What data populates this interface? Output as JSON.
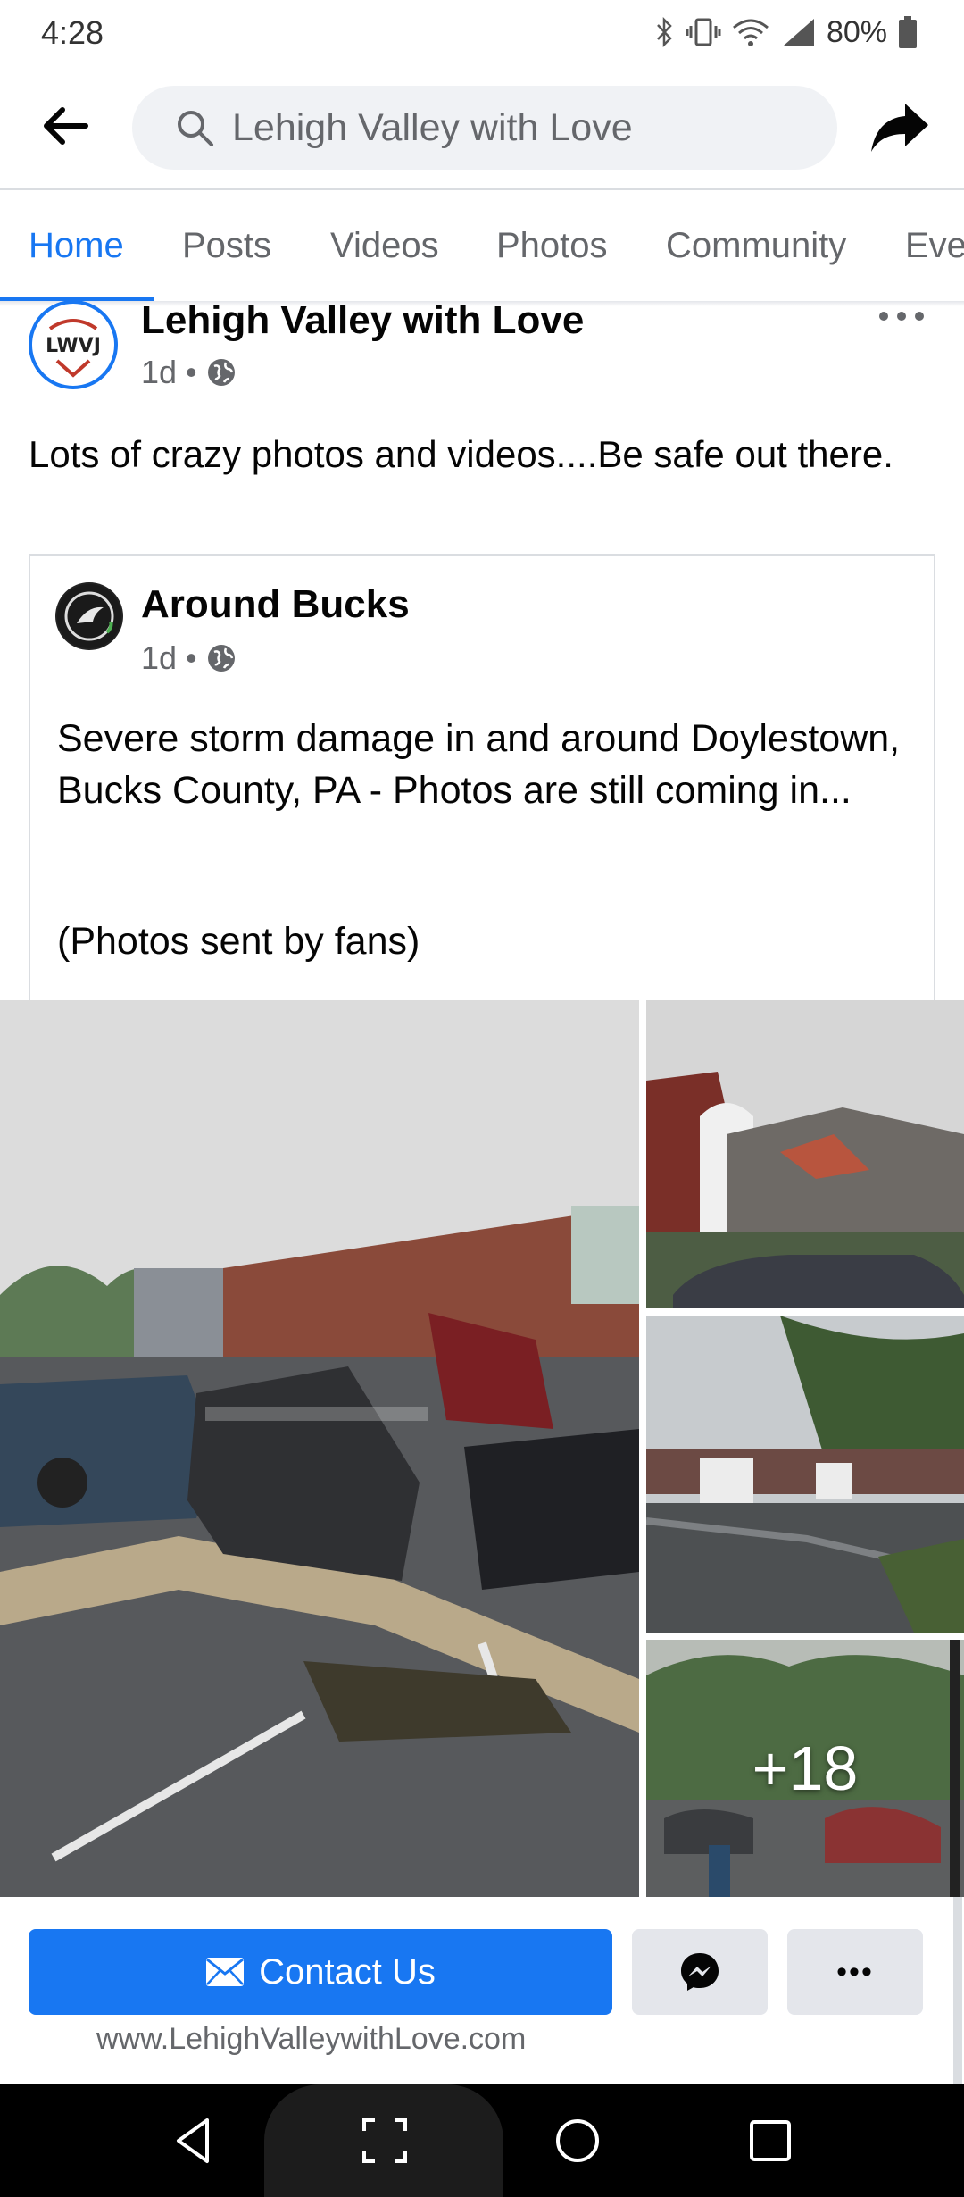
{
  "status_bar": {
    "time": "4:28",
    "battery": "80%",
    "icons": [
      "bluetooth-icon",
      "vibrate-icon",
      "wifi-icon",
      "signal-icon",
      "battery-icon"
    ]
  },
  "top_bar": {
    "search_text": "Lehigh Valley with Love",
    "back_icon": "back-arrow-icon",
    "share_icon": "share-arrow-icon"
  },
  "tabs": [
    {
      "label": "Home",
      "active": true
    },
    {
      "label": "Posts",
      "active": false
    },
    {
      "label": "Videos",
      "active": false
    },
    {
      "label": "Photos",
      "active": false
    },
    {
      "label": "Community",
      "active": false
    },
    {
      "label": "Even",
      "active": false
    }
  ],
  "post": {
    "page_name": "Lehigh Valley with Love",
    "avatar_text": "LWVJ",
    "time": "1d",
    "separator": "•",
    "text": "Lots of crazy photos and videos....Be safe out there.",
    "shared": {
      "name": "Around Bucks",
      "time": "1d",
      "separator": "•",
      "text": "Severe storm damage in and around Doylestown, Bucks County, PA - Photos are still coming in...",
      "caption": "(Photos sent by fans)"
    },
    "photos": {
      "more_count": "+18"
    }
  },
  "actions": {
    "contact_label": "Contact Us",
    "more_label": "•••",
    "website": "www.LehighValleywithLove.com"
  },
  "colors": {
    "accent": "#1877f2",
    "secondary_button": "#e4e6eb",
    "muted_text": "#65676b"
  }
}
